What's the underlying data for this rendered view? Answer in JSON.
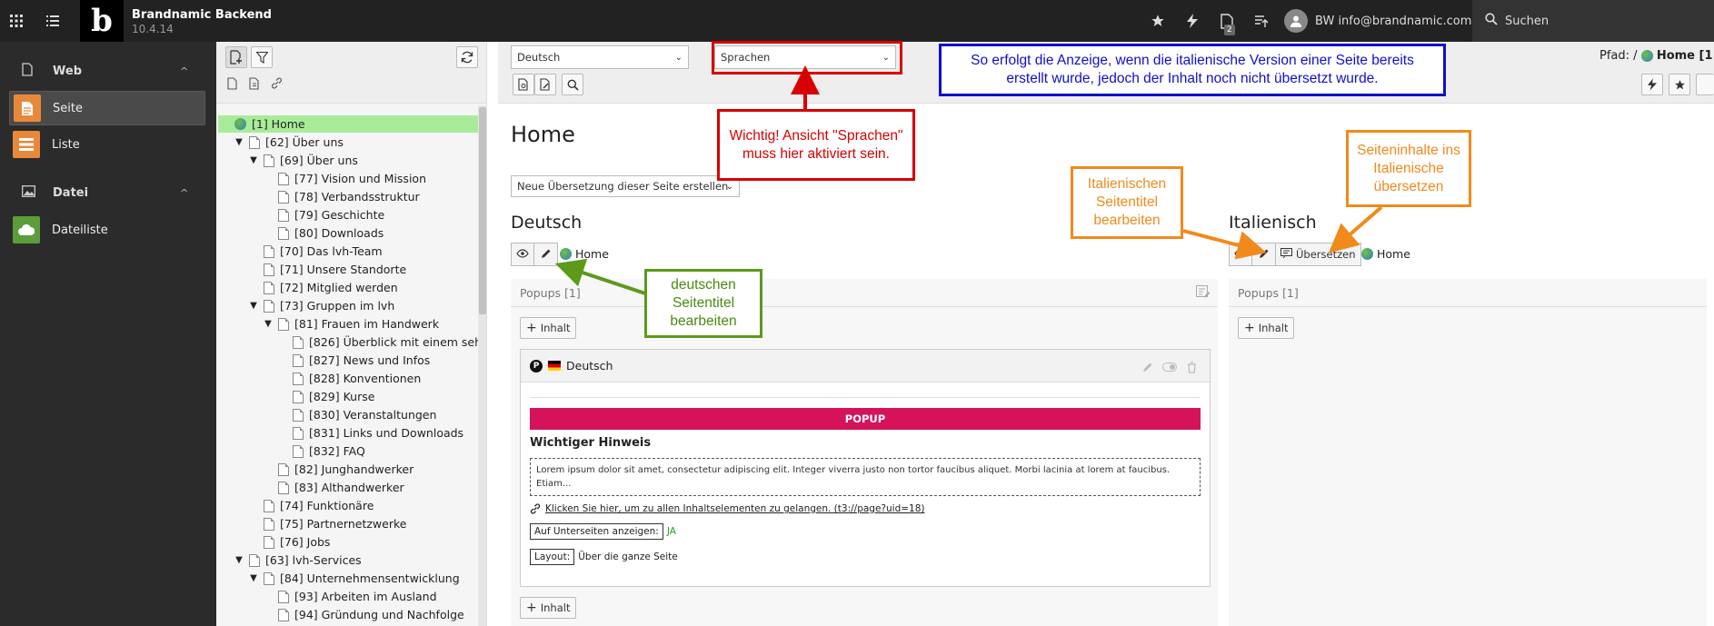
{
  "topbar": {
    "app_name": "Brandnamic Backend",
    "version": "10.4.14",
    "logo_letter": "b",
    "user": "BW info@brandnamic.com",
    "search_label": "Suchen",
    "notification_count": "2"
  },
  "modules": {
    "web": {
      "label": "Web",
      "items": [
        {
          "label": "Seite",
          "color": "#e8893a"
        },
        {
          "label": "Liste",
          "color": "#e8893a"
        }
      ]
    },
    "datei": {
      "label": "Datei",
      "items": [
        {
          "label": "Dateiliste",
          "color": "#5b9d3b"
        }
      ]
    }
  },
  "tree": {
    "nodes": [
      {
        "label": "[1] Home",
        "level": 0,
        "toggle": "",
        "selected": true
      },
      {
        "label": "[62] Über uns",
        "level": 1,
        "toggle": "▼"
      },
      {
        "label": "[69] Über uns",
        "level": 2,
        "toggle": "▼"
      },
      {
        "label": "[77] Vision und Mission",
        "level": 3,
        "toggle": ""
      },
      {
        "label": "[78] Verbandsstruktur",
        "level": 3,
        "toggle": ""
      },
      {
        "label": "[79] Geschichte",
        "level": 3,
        "toggle": ""
      },
      {
        "label": "[80] Downloads",
        "level": 3,
        "toggle": ""
      },
      {
        "label": "[70] Das lvh-Team",
        "level": 2,
        "toggle": ""
      },
      {
        "label": "[71] Unsere Standorte",
        "level": 2,
        "toggle": ""
      },
      {
        "label": "[72] Mitglied werden",
        "level": 2,
        "toggle": ""
      },
      {
        "label": "[73] Gruppen im lvh",
        "level": 2,
        "toggle": "▼"
      },
      {
        "label": "[81] Frauen im Handwerk",
        "level": 3,
        "toggle": "▼"
      },
      {
        "label": "[826] Überblick mit einem seh",
        "level": 4,
        "toggle": ""
      },
      {
        "label": "[827] News und Infos",
        "level": 4,
        "toggle": ""
      },
      {
        "label": "[828] Konventionen",
        "level": 4,
        "toggle": ""
      },
      {
        "label": "[829] Kurse",
        "level": 4,
        "toggle": ""
      },
      {
        "label": "[830] Veranstaltungen",
        "level": 4,
        "toggle": ""
      },
      {
        "label": "[831] Links und Downloads",
        "level": 4,
        "toggle": ""
      },
      {
        "label": "[832] FAQ",
        "level": 4,
        "toggle": ""
      },
      {
        "label": "[82] Junghandwerker",
        "level": 3,
        "toggle": ""
      },
      {
        "label": "[83] Althandwerker",
        "level": 3,
        "toggle": ""
      },
      {
        "label": "[74] Funktionäre",
        "level": 2,
        "toggle": ""
      },
      {
        "label": "[75] Partnernetzwerke",
        "level": 2,
        "toggle": ""
      },
      {
        "label": "[76] Jobs",
        "level": 2,
        "toggle": ""
      },
      {
        "label": "[63] lvh-Services",
        "level": 1,
        "toggle": "▼"
      },
      {
        "label": "[84] Unternehmensentwicklung",
        "level": 2,
        "toggle": "▼"
      },
      {
        "label": "[93] Arbeiten im Ausland",
        "level": 3,
        "toggle": ""
      },
      {
        "label": "[94] Gründung und Nachfolge",
        "level": 3,
        "toggle": ""
      }
    ]
  },
  "docheader": {
    "language_select": "Deutsch",
    "view_select": "Sprachen",
    "path_label": "Pfad: /",
    "path_page": "Home [1"
  },
  "main": {
    "page_title": "Home",
    "translation_select": "Neue Übersetzung dieser Seite erstellen",
    "col_de": {
      "title": "Deutsch",
      "page": "Home",
      "colpos": "Popups [1]",
      "add_label": "Inhalt"
    },
    "col_it": {
      "title": "Italienisch",
      "page": "Home",
      "translate_label": "Übersetzen",
      "colpos": "Popups [1]",
      "add_label": "Inhalt"
    },
    "ce": {
      "lang": "Deutsch",
      "badge": "P",
      "bar": "POPUP",
      "heading": "Wichtiger Hinweis",
      "body": "Lorem ipsum dolor sit amet, consectetur adipiscing elit. Integer viverra justo non tortor faucibus aliquet. Morbi lacinia at lorem at faucibus. Etiam...",
      "link": "Klicken Sie hier, um zu allen Inhaltselementen zu gelangen. (t3://page?uid=18)",
      "sub_key": "Auf Unterseiten anzeigen:",
      "sub_val": "JA",
      "layout_key": "Layout:",
      "layout_val": "Über die ganze Seite"
    }
  },
  "annotations": {
    "red": "Wichtig! Ansicht \"Sprachen\" muss hier aktiviert sein.",
    "blue": "So erfolgt die Anzeige, wenn die italienische Version einer Seite bereits erstellt wurde, jedoch der Inhalt noch nicht übersetzt wurde.",
    "green": "deutschen Seitentitel bearbeiten",
    "orange1": "Italienischen Seitentitel bearbeiten",
    "orange2": "Seiteninhalte ins Italienische übersetzen"
  },
  "colors": {
    "red": "#d80000",
    "blue": "#1010c8",
    "green": "#5c9a1a",
    "orange": "#f08a1c",
    "popup": "#d4135a",
    "selected_tree": "#a8ec9a"
  }
}
